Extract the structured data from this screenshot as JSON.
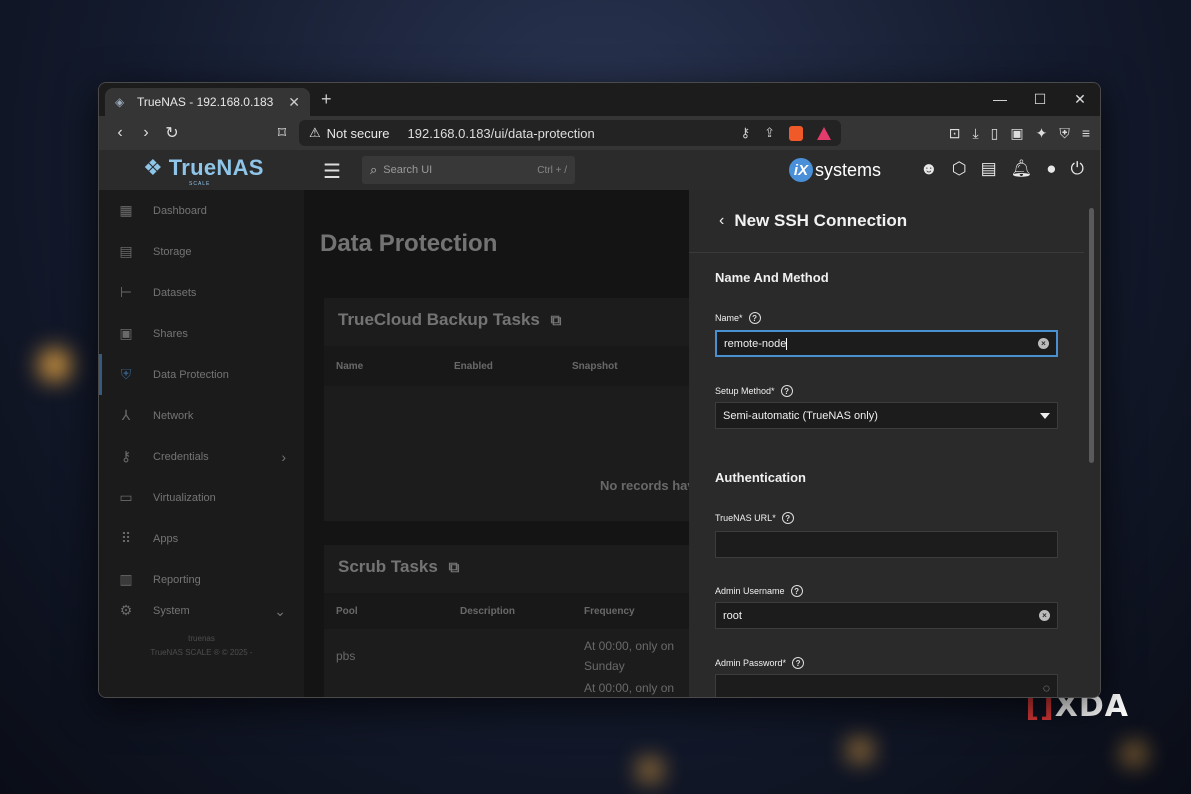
{
  "browser": {
    "tab_title": "TrueNAS - 192.168.0.183",
    "security_label": "Not secure",
    "url": "192.168.0.183/ui/data-protection"
  },
  "header": {
    "brand": "TrueNAS",
    "brand_sub": "SCALE",
    "search_placeholder": "Search UI",
    "search_shortcut": "Ctrl + /",
    "vendor": "systems"
  },
  "sidebar": {
    "items": [
      {
        "label": "Dashboard",
        "icon": "dashboard-icon"
      },
      {
        "label": "Storage",
        "icon": "storage-icon"
      },
      {
        "label": "Datasets",
        "icon": "datasets-icon"
      },
      {
        "label": "Shares",
        "icon": "shares-icon"
      },
      {
        "label": "Data Protection",
        "icon": "shield-icon"
      },
      {
        "label": "Network",
        "icon": "network-icon"
      },
      {
        "label": "Credentials",
        "icon": "key-icon"
      },
      {
        "label": "Virtualization",
        "icon": "laptop-icon"
      },
      {
        "label": "Apps",
        "icon": "apps-icon"
      },
      {
        "label": "Reporting",
        "icon": "chart-icon"
      },
      {
        "label": "System",
        "icon": "system-icon"
      }
    ],
    "footer_line1": "truenas",
    "footer_line2": "TrueNAS SCALE ® © 2025 -"
  },
  "main": {
    "title": "Data Protection",
    "cloud_card": {
      "title": "TrueCloud Backup Tasks",
      "columns": [
        "Name",
        "Enabled",
        "Snapshot"
      ],
      "empty": "No records hav"
    },
    "scrub_card": {
      "title": "Scrub Tasks",
      "columns": [
        "Pool",
        "Description",
        "Frequency"
      ],
      "rows": [
        {
          "pool": "pbs",
          "freq_1": "At 00:00, only on",
          "freq_2": "Sunday"
        },
        {
          "pool": "",
          "freq_1": "At 00:00, only on",
          "freq_2": ""
        }
      ]
    }
  },
  "panel": {
    "title": "New SSH Connection",
    "section_1": "Name And Method",
    "name_label": "Name",
    "name_value": "remote-node",
    "setup_label": "Setup Method",
    "setup_value": "Semi-automatic (TrueNAS only)",
    "section_2": "Authentication",
    "url_label": "TrueNAS URL",
    "url_value": "",
    "admin_label": "Admin Username",
    "admin_value": "root",
    "password_label": "Admin Password",
    "password_value": "",
    "required_mark": "*"
  },
  "watermark": "XDA",
  "colors": {
    "accent": "#4a8fd0",
    "brand": "#8fc5e8",
    "panel_bg": "#2a2a2a"
  }
}
